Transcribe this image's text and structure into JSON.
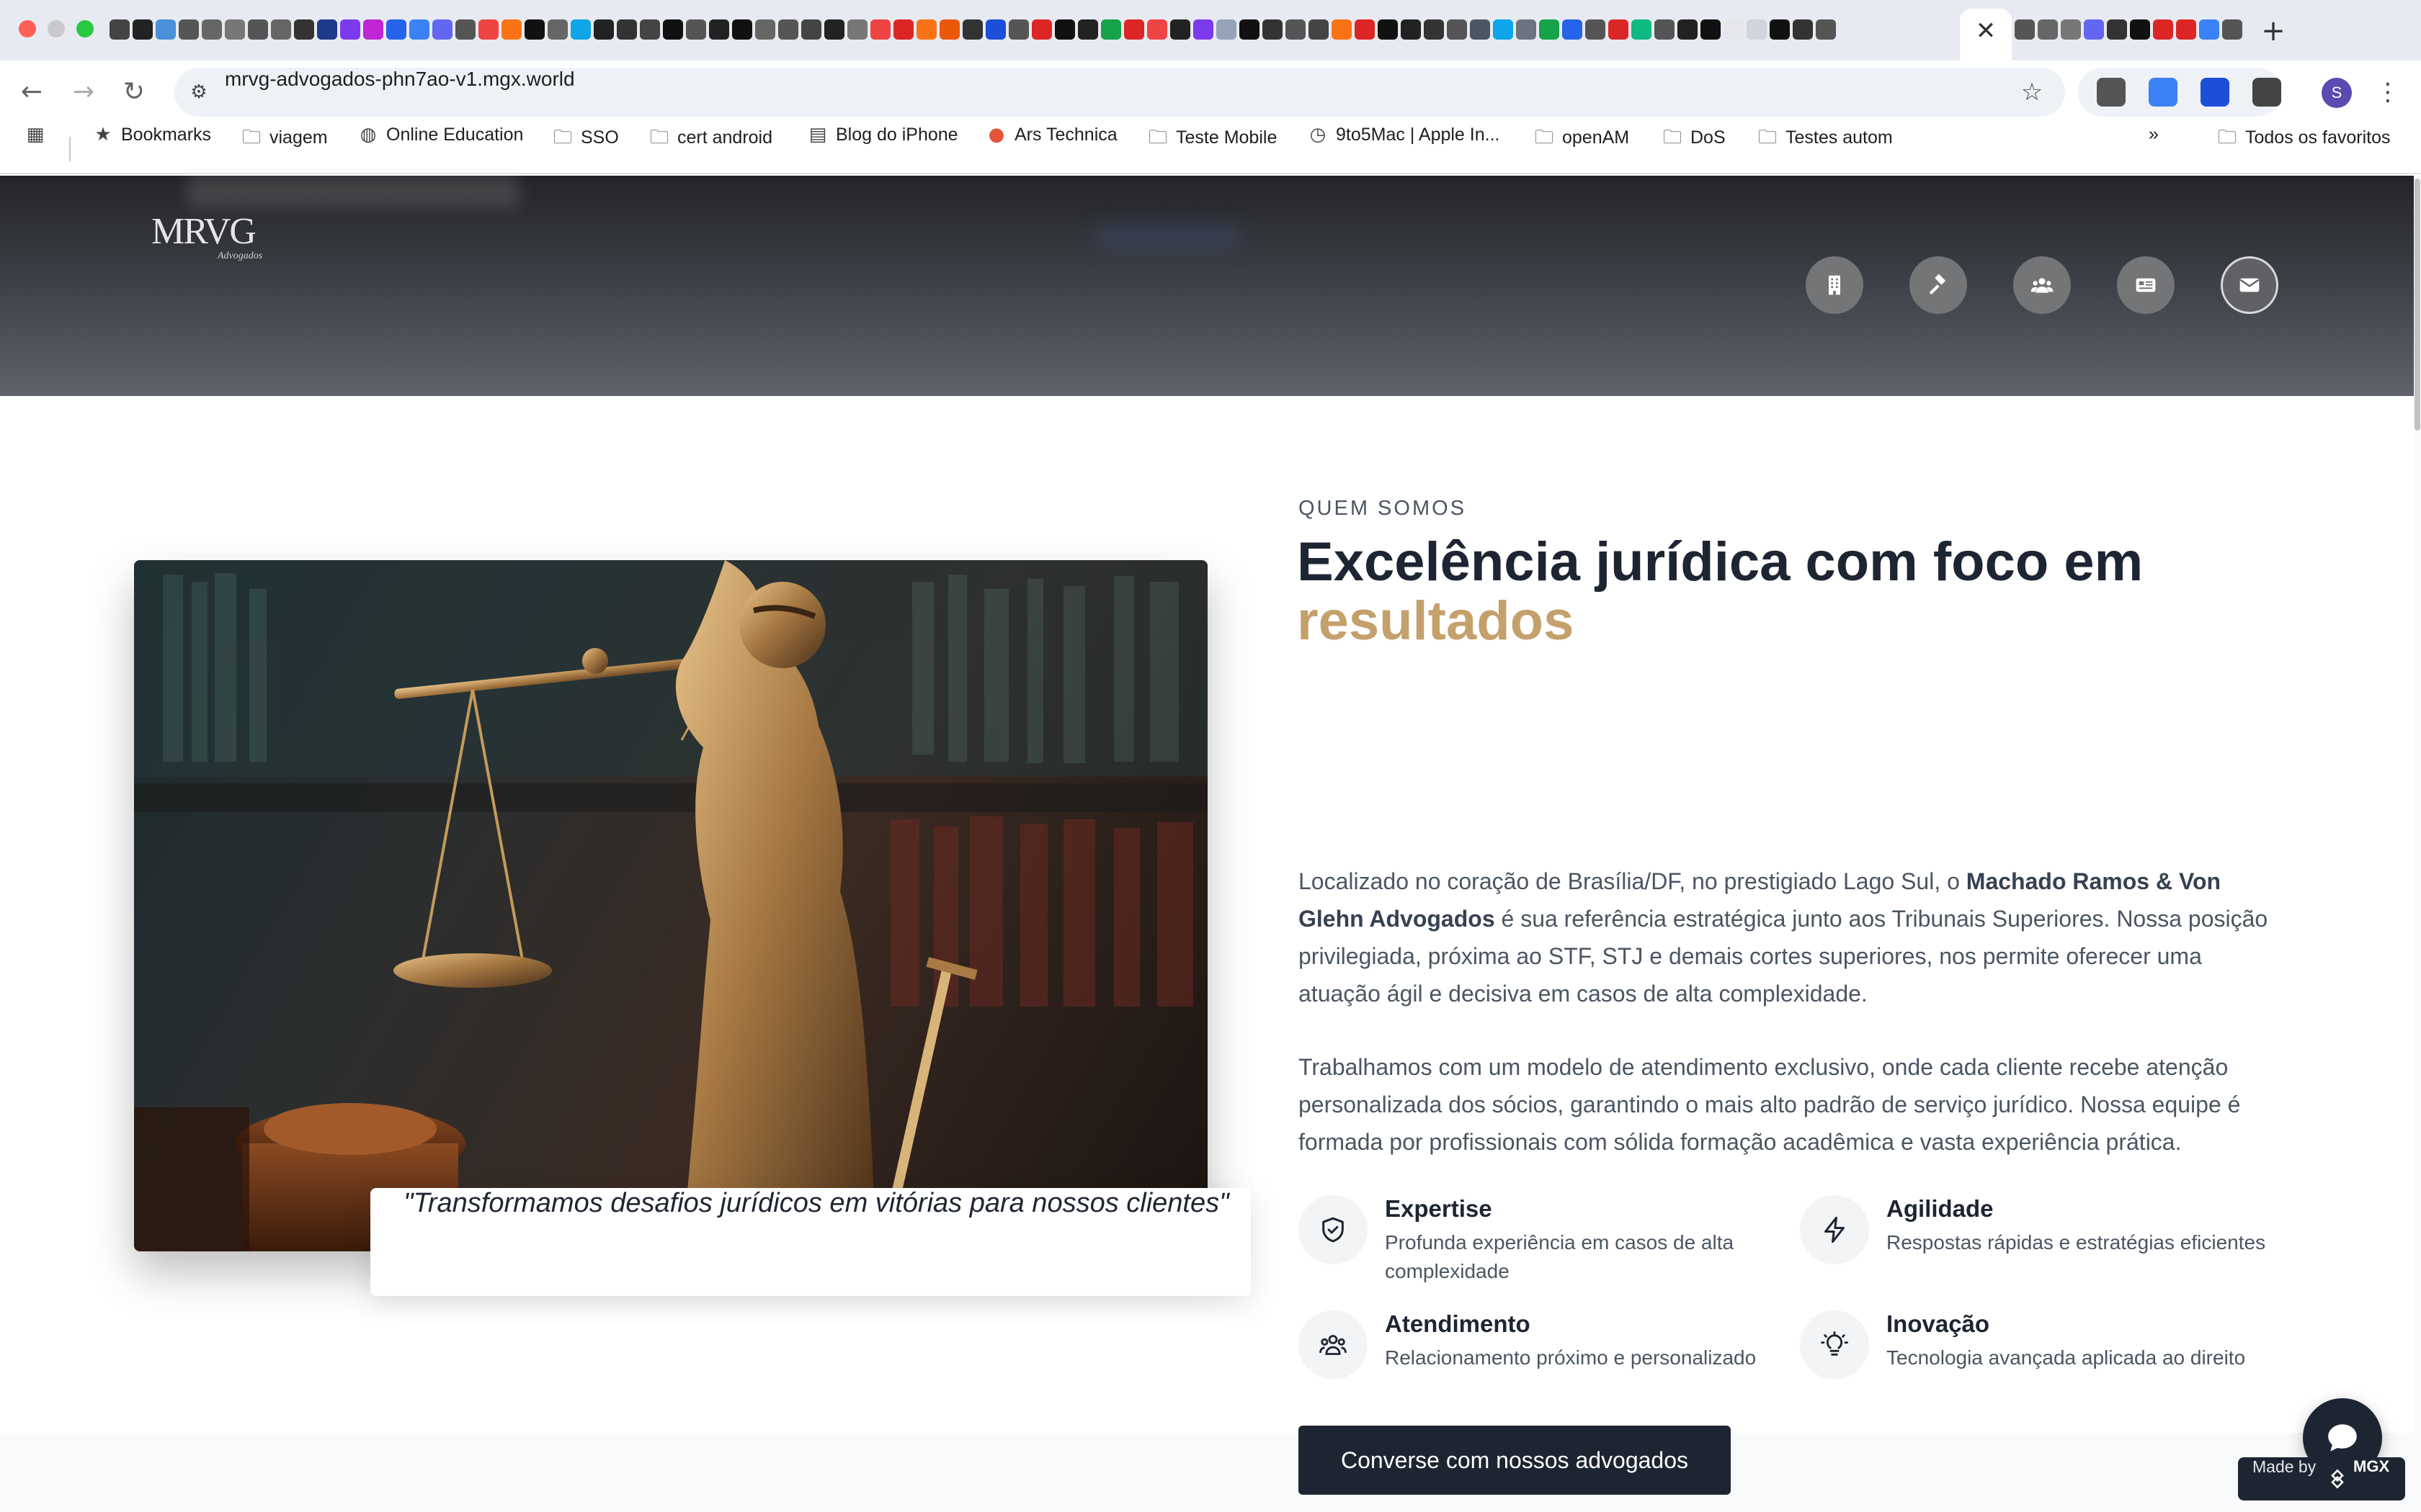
{
  "browser": {
    "tab_close": "✕",
    "new_tab": "+",
    "url": "mrvg-advogados-phn7ao-v1.mgx.world",
    "favicon_colors": [
      "#444",
      "#222",
      "#4a90d9",
      "#555",
      "#666",
      "#777",
      "#555",
      "#666",
      "#333",
      "#1e3a8a",
      "#7c3aed",
      "#c026d3",
      "#2563eb",
      "#3b82f6",
      "#6366f1",
      "#555",
      "#ef4444",
      "#f97316",
      "#111",
      "#666",
      "#0ea5e9",
      "#222",
      "#333",
      "#444",
      "#111",
      "#555",
      "#222",
      "#111",
      "#666",
      "#555",
      "#444",
      "#222",
      "#777",
      "#ef4444",
      "#dc2626",
      "#f97316",
      "#ea580c",
      "#333",
      "#1d4ed8",
      "#555",
      "#dc2626",
      "#111",
      "#222",
      "#16a34a",
      "#dc2626",
      "#ef4444",
      "#222",
      "#7c3aed",
      "#94a3b8",
      "#111",
      "#333",
      "#555",
      "#444",
      "#f97316",
      "#dc2626",
      "#111",
      "#222",
      "#333",
      "#555",
      "#4b5563",
      "#0ea5e9",
      "#6b7280",
      "#16a34a",
      "#2563eb",
      "#555",
      "#dc2626",
      "#10b981",
      "#555",
      "#222",
      "#111",
      "#e5e7eb",
      "#d1d5db",
      "#111",
      "#333",
      "#555"
    ],
    "favicon_colors_right": [
      "#555",
      "#666",
      "#777",
      "#6366f1",
      "#333",
      "#111",
      "#dc2626",
      "#dc2626",
      "#3b82f6",
      "#555"
    ],
    "extension_colors": [
      "#555",
      "#3b82f6",
      "#1d4ed8",
      "#444"
    ],
    "profile_initial": "S",
    "bookmarks": [
      {
        "label": "Bookmarks",
        "icon": "star-icon"
      },
      {
        "label": "viagem",
        "icon": "folder-icon"
      },
      {
        "label": "Online Education",
        "icon": "globe-icon"
      },
      {
        "label": "SSO",
        "icon": "folder-icon"
      },
      {
        "label": "cert android",
        "icon": "folder-icon"
      },
      {
        "label": "Blog do iPhone",
        "icon": "site-icon"
      },
      {
        "label": "Ars Technica",
        "icon": "ars-icon"
      },
      {
        "label": "Teste Mobile",
        "icon": "folder-icon"
      },
      {
        "label": "9to5Mac | Apple In...",
        "icon": "clock-icon"
      },
      {
        "label": "openAM",
        "icon": "folder-icon"
      },
      {
        "label": "DoS",
        "icon": "folder-icon"
      },
      {
        "label": "Testes autom",
        "icon": "folder-icon"
      }
    ],
    "bookmarks_overflow": "»",
    "all_bookmarks": "Todos os favoritos"
  },
  "site": {
    "logo": {
      "main": "MRVG",
      "sub": "Advogados"
    },
    "nav_icons": [
      "building-icon",
      "gavel-icon",
      "users-icon",
      "newspaper-icon",
      "envelope-icon"
    ],
    "about": {
      "eyebrow": "QUEM SOMOS",
      "heading": "Excelência jurídica com foco em",
      "heading_accent": "resultados",
      "para1_before": "Localizado no coração de Brasília/DF, no prestigiado Lago Sul, o ",
      "para1_bold": "Machado Ramos & Von Glehn Advogados",
      "para1_after": " é sua referência estratégica junto aos Tribunais Superiores. Nossa posição privilegiada, próxima ao STF, STJ e demais cortes superiores, nos permite oferecer uma atuação ágil e decisiva em casos de alta complexidade.",
      "para2": "Trabalhamos com um modelo de atendimento exclusivo, onde cada cliente recebe atenção personalizada dos sócios, garantindo o mais alto padrão de serviço jurídico. Nossa equipe é formada por profissionais com sólida formação acadêmica e vasta experiência prática.",
      "quote": "\"Transformamos desafios jurídicos em vitórias para nossos clientes\"",
      "features": [
        {
          "icon": "shield-check-icon",
          "title": "Expertise",
          "desc": "Profunda experiência em casos de alta complexidade"
        },
        {
          "icon": "lightning-icon",
          "title": "Agilidade",
          "desc": "Respostas rápidas e estratégias eficientes"
        },
        {
          "icon": "users-icon",
          "title": "Atendimento",
          "desc": "Relacionamento próximo e personalizado"
        },
        {
          "icon": "lightbulb-icon",
          "title": "Inovação",
          "desc": "Tecnologia avançada aplicada ao direito"
        }
      ],
      "cta": "Converse com nossos advogados"
    },
    "made_by": {
      "label": "Made by",
      "brand": "MGX"
    },
    "colors": {
      "navy": "#1e2532",
      "gold": "#c4a06b",
      "text": "#4b5563"
    }
  }
}
